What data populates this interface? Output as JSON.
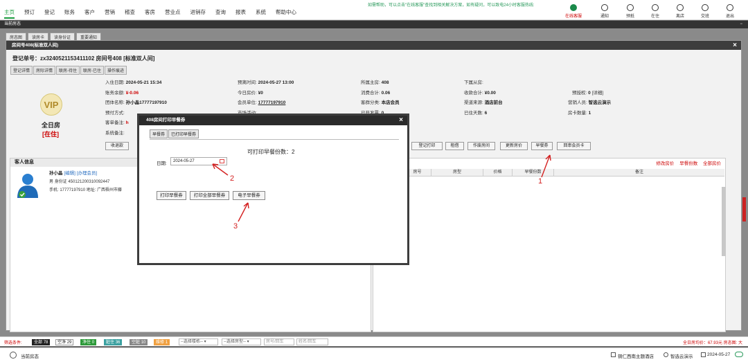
{
  "nav": {
    "items": [
      "主页",
      "预订",
      "登记",
      "账务",
      "客户",
      "营销",
      "稽查",
      "客房",
      "营业点",
      "进销存",
      "查询",
      "报表",
      "系统",
      "帮助中心"
    ],
    "hint": "如需帮助，可以点击\"在线客服\"查找到相关解决方案，如有疑问，可以致电24小时客服热线:"
  },
  "toolbar": [
    "在线客服",
    "通知",
    "预抵",
    "在住",
    "离店",
    "交班",
    "退出"
  ],
  "current_bar": {
    "title": "当前房态",
    "minimize": "−"
  },
  "bg_tabs": [
    "房态图",
    "读房卡",
    "读身份证",
    "重要通知"
  ],
  "room_window": {
    "title": "房间号408(标准双人间)",
    "close": "×",
    "reg_no": "登记单号：zx3240521153411102 房间号408 [标准双人间]",
    "subtabs": [
      "登记详情",
      "房际详情",
      "联房-待住",
      "联房-已住",
      "操作痕迹"
    ],
    "vip": "VIP",
    "full_day": "全日房",
    "status": "[在住]",
    "fields": {
      "checkin_label": "入住日期:",
      "checkin": "2024-05-21 15:34",
      "balance_label": "账务余额:",
      "balance": "¥-0.06",
      "group_label": "团体名称:",
      "group": "孙小晶17777197910",
      "prepay_label": "预付方式:",
      "prepay": "",
      "guest_note_label": "客单备注:",
      "guest_note": "h",
      "sys_note_label": "系统备注:",
      "sys_note": "",
      "checkout_label": "预离时间:",
      "checkout": "2024-05-27 13:00",
      "today_price_label": "今日房价:",
      "today_price": "¥0",
      "member_label": "会员单位:",
      "member": "17777197910",
      "market_label": "市场活动:",
      "market": "",
      "main_room_label": "所属主房:",
      "main_room": "408",
      "consume_label": "消费合计:",
      "consume": "0.06",
      "guest_class_label": "客群分类:",
      "guest_class": "本店会员",
      "invoice_label": "已开发票:",
      "invoice": "0",
      "sub_room_label": "下属从房:",
      "sub_room": "",
      "payment_label": "收款合计:",
      "payment": "¥0.00",
      "channel_label": "渠道来源:",
      "channel": "酒店前台",
      "days_label": "已住天数:",
      "days": "6",
      "preauth_label": "预授权:",
      "preauth": "0",
      "preauth_detail": "[详细]",
      "sales_label": "营销人员:",
      "sales": "智选云演示",
      "cards_label": "房卡数量:",
      "cards": "1"
    },
    "actions": [
      "收退款",
      "登记打印",
      "租借",
      "作废房间",
      "更新房价",
      "早餐券",
      "回串会员卡"
    ],
    "guest": {
      "header": "客人信息",
      "name": "孙小晶",
      "edit": "[编辑]",
      "member_link": "[办理会员]",
      "idline": "男 身份证 450121200310092447",
      "phone": "手机: 17777197910 地址: 广西梧州市藤"
    },
    "right_links": [
      "修改房价",
      "早餐份数",
      "全部房价"
    ],
    "columns": [
      "房号",
      "房型",
      "价格",
      "早餐份数",
      "备注"
    ]
  },
  "dialog": {
    "title": "408房间打印早餐券",
    "close": "×",
    "tabs": [
      "早餐券",
      "已打印早餐券"
    ],
    "count_text": "可打印早餐份数：2",
    "date_label": "日期:",
    "date_value": "2024-05-27",
    "buttons": [
      "打印早餐券",
      "打印全部早餐券",
      "电子早餐券"
    ]
  },
  "annotations": [
    "1",
    "2",
    "3"
  ],
  "filter": {
    "label": "筛选条件:",
    "chips": [
      {
        "name": "全部",
        "count": "78",
        "bg": "#222",
        "fg": "#fff"
      },
      {
        "name": "空净",
        "count": "29",
        "bg": "#fff",
        "fg": "#222"
      },
      {
        "name": "净住",
        "count": "0",
        "bg": "#2d9a3a",
        "fg": "#fff"
      },
      {
        "name": "脏住",
        "count": "36",
        "bg": "#3aa0a0",
        "fg": "#fff"
      },
      {
        "name": "空脏",
        "count": "10",
        "bg": "#888",
        "fg": "#fff"
      },
      {
        "name": "维修",
        "count": "1",
        "bg": "#f0a040",
        "fg": "#fff"
      }
    ],
    "building_select": "--选择楼栋--",
    "type_select": "--选择房型--",
    "room_placeholder": "房号/回车",
    "name_placeholder": "姓名/回车",
    "right": "全日房均价：67.93元  房态图: 大"
  },
  "status": {
    "left": "当前房态",
    "hotel": "铜仁西南主题酒店",
    "user": "智选云演示",
    "date": "2024-05-27"
  }
}
